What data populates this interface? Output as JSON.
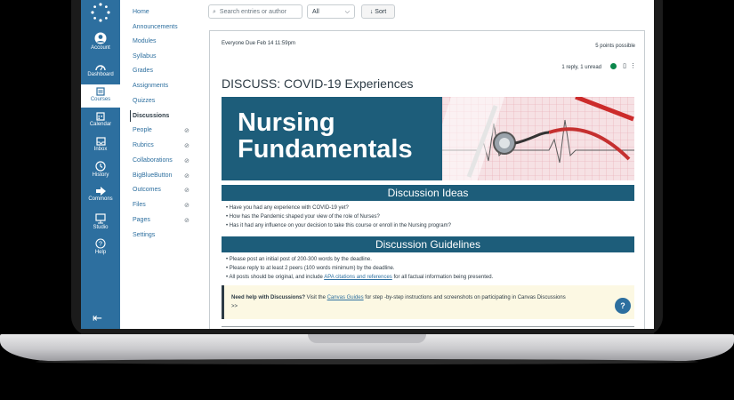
{
  "global_nav": {
    "items": [
      {
        "label": "Account",
        "icon": "account-icon"
      },
      {
        "label": "Dashboard",
        "icon": "dashboard-icon"
      },
      {
        "label": "Courses",
        "icon": "courses-icon"
      },
      {
        "label": "Calendar",
        "icon": "calendar-icon"
      },
      {
        "label": "Inbox",
        "icon": "inbox-icon"
      },
      {
        "label": "History",
        "icon": "history-icon"
      },
      {
        "label": "Commons",
        "icon": "commons-icon"
      },
      {
        "label": "Studio",
        "icon": "studio-icon"
      },
      {
        "label": "Help",
        "icon": "help-icon"
      }
    ],
    "active": "Courses"
  },
  "course_nav": {
    "items": [
      "Home",
      "Announcements",
      "Modules",
      "Syllabus",
      "Grades",
      "Assignments",
      "Quizzes",
      "Discussions",
      "People",
      "Rubrics",
      "Collaborations",
      "BigBlueButton",
      "Outcomes",
      "Files",
      "Pages",
      "Settings"
    ],
    "active": "Discussions",
    "hidden_items": [
      "People",
      "Rubrics",
      "Collaborations",
      "BigBlueButton",
      "Outcomes",
      "Files",
      "Pages"
    ]
  },
  "toolbar": {
    "search_placeholder": "Search entries or author",
    "filter_value": "All",
    "sort_label": "Sort"
  },
  "post": {
    "audience_due": "Everyone   Due Feb 14 11:59pm",
    "points": "5 points possible",
    "replies": "1 reply, 1 unread",
    "title": "DISCUSS: COVID-19 Experiences",
    "banner_line1": "Nursing",
    "banner_line2": "Fundamentals",
    "ideas_header": "Discussion Ideas",
    "ideas": [
      "Have you had any experience with COVID-19 yet?",
      "How has the Pandemic shaped your view of the role of Nurses?",
      "Has it had any influence on your decision to take this course or enroll in the Nursing program?"
    ],
    "guidelines_header": "Discussion Guidelines",
    "guidelines": [
      "Please post an initial post of 200-300 words by the deadline.",
      "Please reply to at least 2 peers (100 words minimum) by the deadline."
    ],
    "guideline3_pre": "All posts should be original, and include ",
    "guideline3_link": "APA citations and references",
    "guideline3_post": " for all factual information being presented.",
    "help_bold": "Need help with Discussions?",
    "help_pre": " Visit the ",
    "help_link": "Canvas Guides",
    "help_post": " for step -by-step instructions and screenshots on participating in Canvas Discussions",
    "help_tail": ">>"
  },
  "colors": {
    "nav_blue": "#2d6f9f",
    "banner_teal": "#1d5d7a",
    "callout_bg": "#fcf8e3",
    "unread_green": "#0b874b"
  }
}
